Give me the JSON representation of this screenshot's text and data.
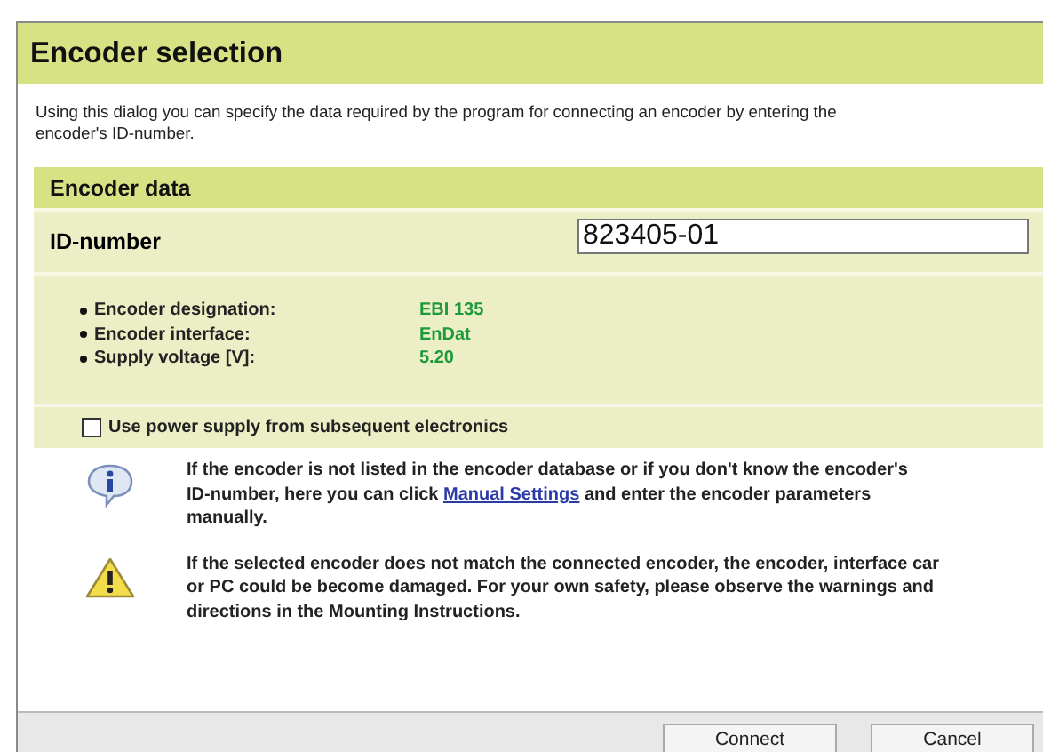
{
  "window": {
    "title": "Encoder selection"
  },
  "intro": "Using this dialog you can specify the data required by the program for connecting an encoder by entering the\nencoder's ID-number.",
  "section": {
    "title": "Encoder data"
  },
  "id_field": {
    "label": "ID-number",
    "value": "823405-01"
  },
  "details": [
    {
      "label": "Encoder designation:",
      "value": "EBI 135"
    },
    {
      "label": "Encoder interface:",
      "value": "EnDat"
    },
    {
      "label": "Supply voltage [V]:",
      "value": "5.20"
    }
  ],
  "power_option": {
    "label": "Use power supply from subsequent electronics",
    "checked": false
  },
  "messages": [
    {
      "kind": "info",
      "before": "If the encoder is not listed in the encoder database or if you don't know the encoder's\nID-number, here you can click ",
      "link": "Manual Settings",
      "after": " and enter the encoder parameters\nmanually."
    },
    {
      "kind": "warning",
      "before": "If the selected encoder does not match the connected encoder, the encoder, interface car\nor PC could be become damaged. For your own safety, please observe the warnings and\ndirections in the Mounting Instructions."
    }
  ],
  "buttons": [
    "Connect",
    "Cancel"
  ]
}
